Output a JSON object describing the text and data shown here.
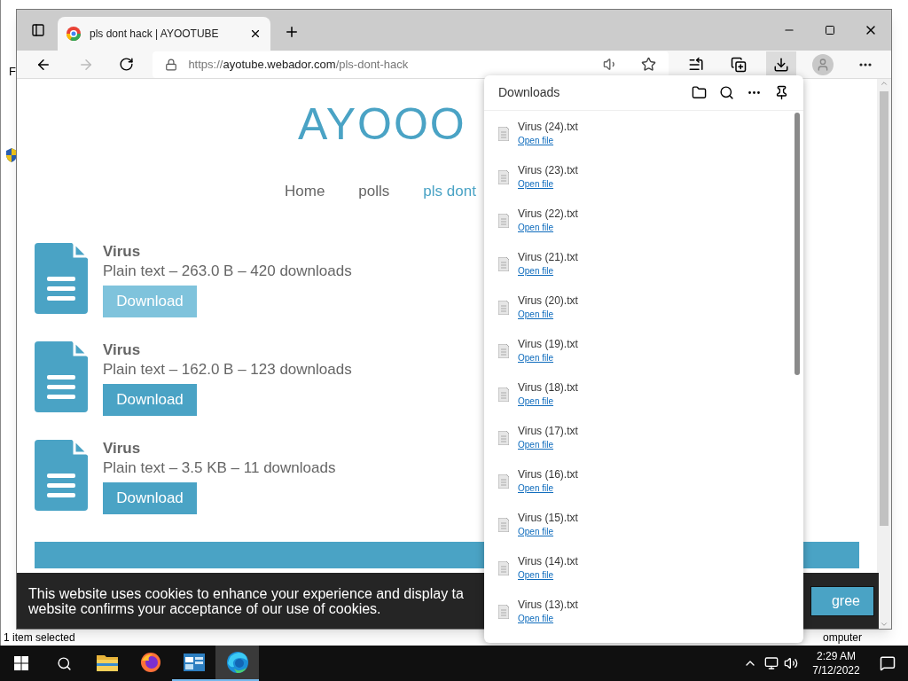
{
  "background_window": {
    "side_text": "F",
    "status_left": "1 item selected",
    "status_right": "omputer"
  },
  "browser": {
    "tab": {
      "title": "pls dont hack | AYOOTUBE"
    },
    "address": {
      "scheme": "https://",
      "host": "ayotube.webador.com",
      "path": "/pls-dont-hack"
    },
    "toolbar": [
      {
        "kind": "favorites",
        "selected": false
      },
      {
        "kind": "collections",
        "selected": false
      },
      {
        "kind": "downloads",
        "selected": true
      },
      {
        "kind": "profile",
        "selected": false
      },
      {
        "kind": "more",
        "selected": false
      }
    ]
  },
  "site": {
    "logo": "AYOOO",
    "nav": [
      {
        "label": "Home",
        "selected": false
      },
      {
        "label": "polls",
        "selected": false
      },
      {
        "label": "pls dont",
        "selected": true
      }
    ],
    "files": [
      {
        "name": "Virus",
        "details": "Plain text – 263.0 B – 420 downloads",
        "button": "Download",
        "hovered": true
      },
      {
        "name": "Virus",
        "details": "Plain text – 162.0 B – 123 downloads",
        "button": "Download",
        "hovered": false
      },
      {
        "name": "Virus",
        "details": "Plain text – 3.5 KB – 11 downloads",
        "button": "Download",
        "hovered": false
      }
    ],
    "cookie": {
      "lines": [
        "This website uses cookies to enhance your experience and display ta",
        "website confirms your acceptance of our use of cookies."
      ],
      "button": "gree"
    }
  },
  "downloads": {
    "title": "Downloads",
    "items": [
      {
        "name": "Virus (24).txt",
        "action": "Open file"
      },
      {
        "name": "Virus (23).txt",
        "action": "Open file"
      },
      {
        "name": "Virus (22).txt",
        "action": "Open file"
      },
      {
        "name": "Virus (21).txt",
        "action": "Open file"
      },
      {
        "name": "Virus (20).txt",
        "action": "Open file"
      },
      {
        "name": "Virus (19).txt",
        "action": "Open file"
      },
      {
        "name": "Virus (18).txt",
        "action": "Open file"
      },
      {
        "name": "Virus (17).txt",
        "action": "Open file"
      },
      {
        "name": "Virus (16).txt",
        "action": "Open file"
      },
      {
        "name": "Virus (15).txt",
        "action": "Open file"
      },
      {
        "name": "Virus (14).txt",
        "action": "Open file"
      },
      {
        "name": "Virus (13).txt",
        "action": "Open file"
      }
    ]
  },
  "taskbar": {
    "apps": [
      {
        "kind": "explorer",
        "running": false,
        "selected": false
      },
      {
        "kind": "firefox",
        "running": false,
        "selected": false
      },
      {
        "kind": "app",
        "running": true,
        "selected": false
      },
      {
        "kind": "edge",
        "running": true,
        "selected": true
      }
    ],
    "time": "2:29 AM",
    "date": "7/12/2022"
  }
}
